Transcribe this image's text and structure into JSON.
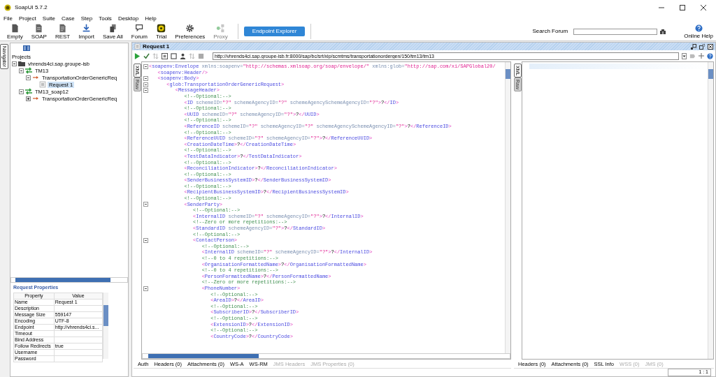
{
  "window": {
    "title": "SoapUI 5.7.2"
  },
  "menu": [
    "File",
    "Project",
    "Suite",
    "Case",
    "Step",
    "Tools",
    "Desktop",
    "Help"
  ],
  "toolbar": {
    "buttons": [
      {
        "label": "Empty",
        "disabled": false
      },
      {
        "label": "SOAP",
        "disabled": false
      },
      {
        "label": "REST",
        "disabled": false
      },
      {
        "label": "Import",
        "disabled": false
      },
      {
        "label": "Save All",
        "disabled": false
      },
      {
        "label": "Forum",
        "disabled": false
      },
      {
        "label": "Trial",
        "disabled": false
      },
      {
        "label": "Preferences",
        "disabled": false
      },
      {
        "label": "Proxy",
        "disabled": true
      }
    ],
    "endpoint_explorer": "Endpoint Explorer",
    "search_label": "Search Forum",
    "online_help": "Online Help"
  },
  "navigator": {
    "tab": "Navigator",
    "projects_label": "Projects",
    "tree": [
      {
        "label": "vhrends4ci.sap.groupe-isb",
        "kind": "project",
        "expanded": true,
        "selected": false,
        "children": [
          {
            "label": "TM13",
            "kind": "interface",
            "expanded": true,
            "selected": false,
            "children": [
              {
                "label": "TransportationOrderGenericReq",
                "kind": "operation",
                "expanded": true,
                "selected": false,
                "children": [
                  {
                    "label": "Request 1",
                    "kind": "request",
                    "selected": true
                  }
                ]
              }
            ]
          },
          {
            "label": "TM13_soap12",
            "kind": "interface",
            "expanded": true,
            "selected": false,
            "children": [
              {
                "label": "TransportationOrderGenericReq",
                "kind": "operation",
                "expanded": false,
                "selected": false
              }
            ]
          }
        ]
      }
    ]
  },
  "request_properties": {
    "title": "Request Properties",
    "columns": [
      "Property",
      "Value"
    ],
    "rows": [
      {
        "property": "Name",
        "value": "Request 1"
      },
      {
        "property": "Description"
      },
      {
        "property": "Message Size",
        "value": "559147"
      },
      {
        "property": "Encoding",
        "value": "UTF-8"
      },
      {
        "property": "Endpoint",
        "value": "http://vhrends4ci.s..."
      },
      {
        "property": "Timeout"
      },
      {
        "property": "Bind Address"
      },
      {
        "property": "Follow Redirects",
        "value": "true"
      },
      {
        "property": "Username"
      },
      {
        "property": "Password"
      }
    ]
  },
  "request": {
    "title": "Request 1",
    "endpoint": "http://vhrends4ci.sap.groupe-isb.fr:8000/sap/bc/srt/xip/scmtms/transportationordergen/150/tm13/tm13",
    "editor_tabs": [
      {
        "label": "XML",
        "selected": true
      },
      {
        "label": "Raw",
        "selected": false
      }
    ],
    "xml_lines": [
      {
        "text": "<soapenv:Envelope xmlns:soapenv=\"http://schemas.xmlsoap.org/soap/envelope/\" xmlns:glob=\"http://sap.com/xi/SAPGlobal20/",
        "foldable": true
      },
      {
        "text": "   <soapenv:Header/>",
        "foldable": false
      },
      {
        "text": "   <soapenv:Body>",
        "foldable": true
      },
      {
        "text": "      <glob:TransportationOrderGenericRequest>",
        "foldable": true
      },
      {
        "text": "         <MessageHeader>",
        "foldable": true
      },
      {
        "text": "            <!--Optional:-->",
        "foldable": false
      },
      {
        "text": "            <ID schemeID=\"?\" schemeAgencyID=\"?\" schemeAgencySchemeAgencyID=\"?\">?</ID>",
        "foldable": false
      },
      {
        "text": "            <!--Optional:-->",
        "foldable": false
      },
      {
        "text": "            <UUID schemeID=\"?\" schemeAgencyID=\"?\">?</UUID>",
        "foldable": false
      },
      {
        "text": "            <!--Optional:-->",
        "foldable": false
      },
      {
        "text": "            <ReferenceID schemeID=\"?\" schemeAgencyID=\"?\" schemeAgencySchemeAgencyID=\"?\">?</ReferenceID>",
        "foldable": false
      },
      {
        "text": "            <!--Optional:-->",
        "foldable": false
      },
      {
        "text": "            <ReferenceUUID schemeID=\"?\" schemeAgencyID=\"?\">?</ReferenceUUID>",
        "foldable": false
      },
      {
        "text": "            <CreationDateTime>?</CreationDateTime>",
        "foldable": false
      },
      {
        "text": "            <!--Optional:-->",
        "foldable": false
      },
      {
        "text": "            <TestDataIndicator>?</TestDataIndicator>",
        "foldable": false
      },
      {
        "text": "            <!--Optional:-->",
        "foldable": false
      },
      {
        "text": "            <ReconciliationIndicator>?</ReconciliationIndicator>",
        "foldable": false
      },
      {
        "text": "            <!--Optional:-->",
        "foldable": false
      },
      {
        "text": "            <SenderBusinessSystemID>?</SenderBusinessSystemID>",
        "foldable": false
      },
      {
        "text": "            <!--Optional:-->",
        "foldable": false
      },
      {
        "text": "            <RecipientBusinessSystemID>?</RecipientBusinessSystemID>",
        "foldable": false
      },
      {
        "text": "            <!--Optional:-->",
        "foldable": false
      },
      {
        "text": "            <SenderParty>",
        "foldable": true
      },
      {
        "text": "               <!--Optional:-->",
        "foldable": false
      },
      {
        "text": "               <InternalID schemeID=\"?\" schemeAgencyID=\"?\">?</InternalID>",
        "foldable": false
      },
      {
        "text": "               <!--Zero or more repetitions:-->",
        "foldable": false
      },
      {
        "text": "               <StandardID schemeAgencyID=\"?\">?</StandardID>",
        "foldable": false
      },
      {
        "text": "               <!--Optional:-->",
        "foldable": false
      },
      {
        "text": "               <ContactPerson>",
        "foldable": true
      },
      {
        "text": "                  <!--Optional:-->",
        "foldable": false
      },
      {
        "text": "                  <InternalID schemeID=\"?\" schemeAgencyID=\"?\">?</InternalID>",
        "foldable": false
      },
      {
        "text": "                  <!--0 to 4 repetitions:-->",
        "foldable": false
      },
      {
        "text": "                  <OrganisationFormattedName>?</OrganisationFormattedName>",
        "foldable": false
      },
      {
        "text": "                  <!--0 to 4 repetitions:-->",
        "foldable": false
      },
      {
        "text": "                  <PersonFormattedName>?</PersonFormattedName>",
        "foldable": false
      },
      {
        "text": "                  <!--Zero or more repetitions:-->",
        "foldable": false
      },
      {
        "text": "                  <PhoneNumber>",
        "foldable": true
      },
      {
        "text": "                     <!--Optional:-->",
        "foldable": false
      },
      {
        "text": "                     <AreaID>?</AreaID>",
        "foldable": false
      },
      {
        "text": "                     <!--Optional:-->",
        "foldable": false
      },
      {
        "text": "                     <SubscriberID>?</SubscriberID>",
        "foldable": false
      },
      {
        "text": "                     <!--Optional:-->",
        "foldable": false
      },
      {
        "text": "                     <ExtensionID>?</ExtensionID>",
        "foldable": false
      },
      {
        "text": "                     <!--Optional:-->",
        "foldable": false
      },
      {
        "text": "                     <CountryCode>?</CountryCode>",
        "foldable": false
      }
    ],
    "tabs": [
      {
        "label": "Auth",
        "disabled": false
      },
      {
        "label": "Headers (0)",
        "disabled": false
      },
      {
        "label": "Attachments (0)",
        "disabled": false
      },
      {
        "label": "WS-A",
        "disabled": false
      },
      {
        "label": "WS-RM",
        "disabled": false
      },
      {
        "label": "JMS Headers",
        "disabled": true
      },
      {
        "label": "JMS Properties (0)",
        "disabled": true
      }
    ]
  },
  "response": {
    "editor_tabs": [
      {
        "label": "XML",
        "selected": true
      },
      {
        "label": "Raw",
        "selected": false
      }
    ],
    "tabs": [
      {
        "label": "Headers (0)",
        "disabled": false
      },
      {
        "label": "Attachments (0)",
        "disabled": false
      },
      {
        "label": "SSL Info",
        "disabled": false
      },
      {
        "label": "WSS (0)",
        "disabled": true
      },
      {
        "label": "JMS (0)",
        "disabled": true
      }
    ],
    "cursor": "1 : 1"
  }
}
